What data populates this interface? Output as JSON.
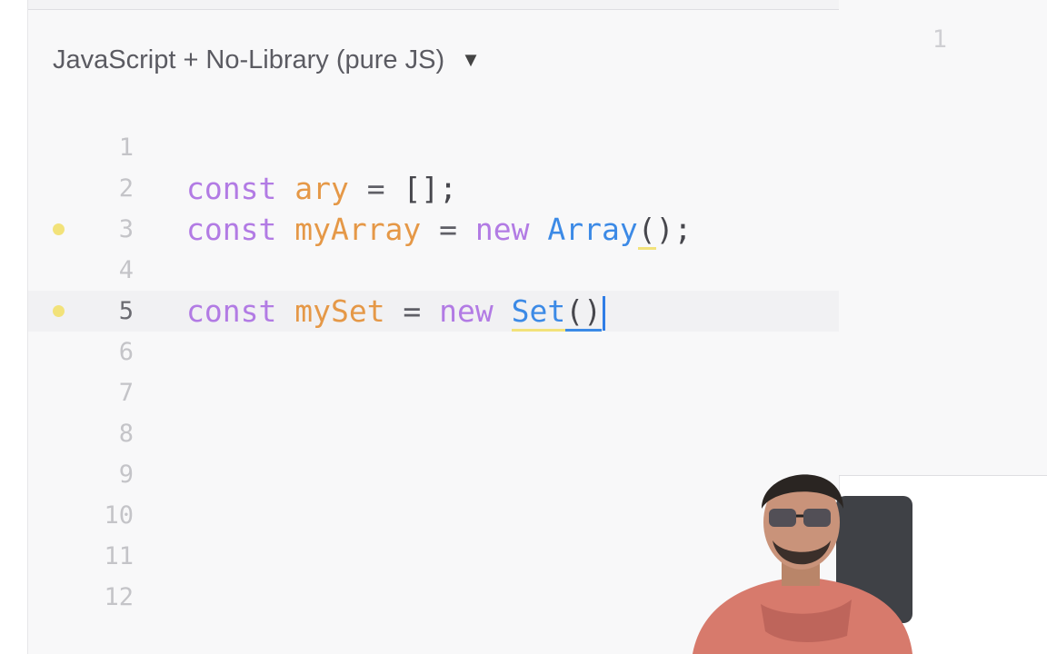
{
  "editor": {
    "language_label": "JavaScript + No-Library (pure JS)",
    "dropdown_icon": "caret-down-icon",
    "lines": [
      {
        "number": "1",
        "tokens": [],
        "marker": false
      },
      {
        "number": "2",
        "tokens": [
          {
            "t": "const",
            "c": "kw"
          },
          {
            "t": " ",
            "c": "op"
          },
          {
            "t": "ary",
            "c": "var"
          },
          {
            "t": " = ",
            "c": "op"
          },
          {
            "t": "[];",
            "c": "punc"
          }
        ],
        "marker": false
      },
      {
        "number": "3",
        "tokens": [
          {
            "t": "const",
            "c": "kw"
          },
          {
            "t": " ",
            "c": "op"
          },
          {
            "t": "myArray",
            "c": "var"
          },
          {
            "t": " = ",
            "c": "op"
          },
          {
            "t": "new",
            "c": "kw"
          },
          {
            "t": " ",
            "c": "op"
          },
          {
            "t": "Array",
            "c": "cls"
          },
          {
            "t": "(",
            "c": "punc squiggle-y"
          },
          {
            "t": ");",
            "c": "punc"
          }
        ],
        "marker": true
      },
      {
        "number": "4",
        "tokens": [],
        "marker": false
      },
      {
        "number": "5",
        "tokens": [
          {
            "t": "const",
            "c": "kw"
          },
          {
            "t": " ",
            "c": "op"
          },
          {
            "t": "mySet",
            "c": "var"
          },
          {
            "t": " = ",
            "c": "op"
          },
          {
            "t": "new",
            "c": "kw"
          },
          {
            "t": " ",
            "c": "op"
          },
          {
            "t": "Set",
            "c": "cls squiggle-y"
          },
          {
            "t": "()",
            "c": "punc squiggle-b"
          }
        ],
        "marker": true,
        "active": true,
        "cursor": true
      },
      {
        "number": "6",
        "tokens": [],
        "marker": false
      },
      {
        "number": "7",
        "tokens": [],
        "marker": false
      },
      {
        "number": "8",
        "tokens": [],
        "marker": false
      },
      {
        "number": "9",
        "tokens": [],
        "marker": false
      },
      {
        "number": "10",
        "tokens": [],
        "marker": false
      },
      {
        "number": "11",
        "tokens": [],
        "marker": false
      },
      {
        "number": "12",
        "tokens": [],
        "marker": false
      }
    ]
  },
  "output": {
    "line_number": "1"
  },
  "colors": {
    "keyword": "#b27be4",
    "variable": "#e59847",
    "class": "#3c8ae6",
    "marker": "#f2e27a"
  }
}
